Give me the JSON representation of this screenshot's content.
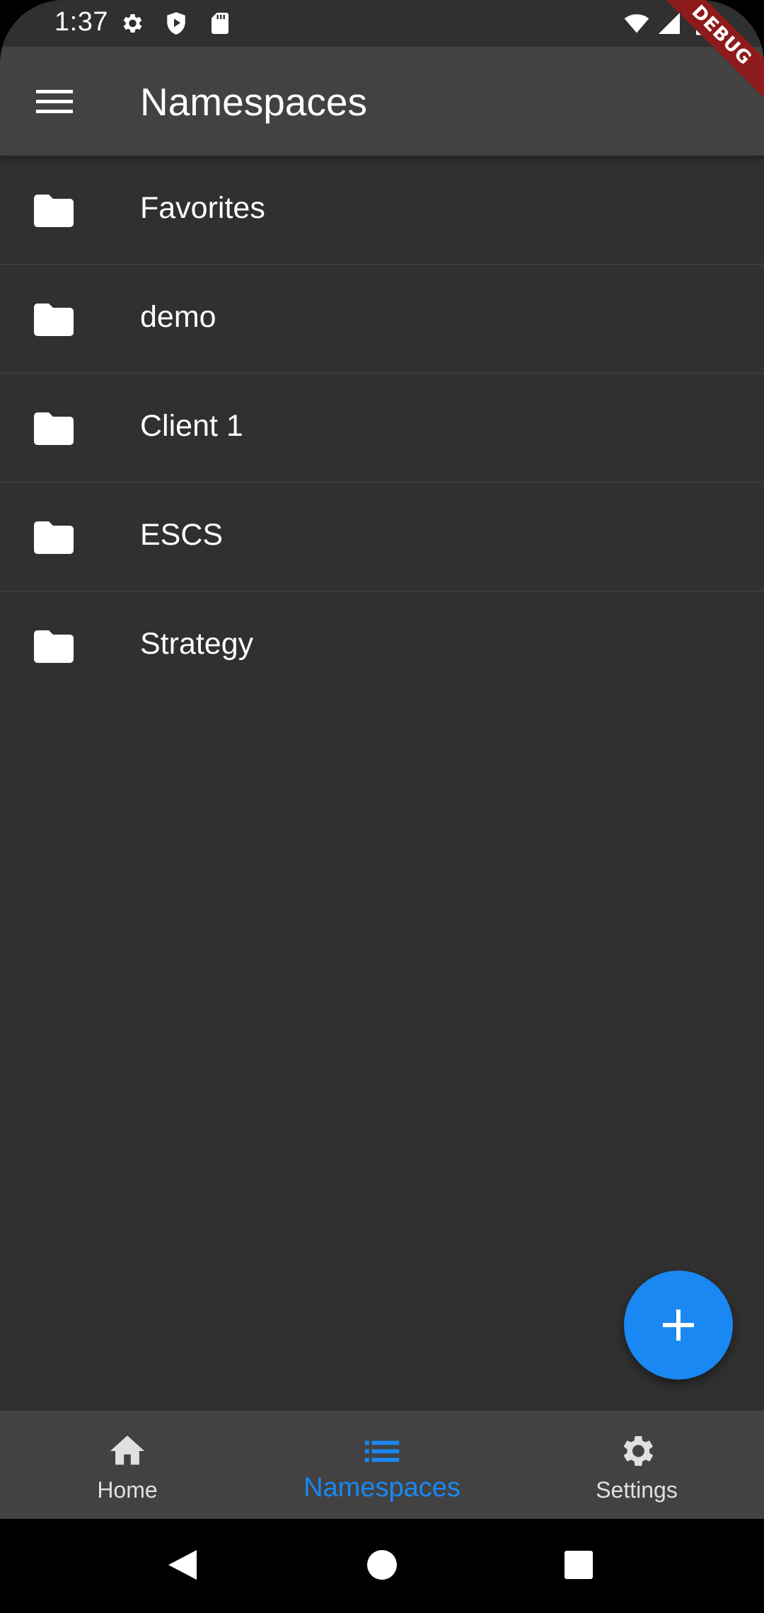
{
  "status_bar": {
    "time": "1:37",
    "icons": [
      "settings-icon",
      "shield-play-icon",
      "sd-card-icon",
      "wifi-icon",
      "signal-icon",
      "battery-icon"
    ]
  },
  "debug_banner": "DEBUG",
  "app_bar": {
    "title": "Namespaces",
    "menu_icon": "hamburger-menu-icon"
  },
  "namespaces": [
    {
      "label": "Favorites",
      "icon": "folder-icon"
    },
    {
      "label": "demo",
      "icon": "folder-icon"
    },
    {
      "label": "Client 1",
      "icon": "folder-icon"
    },
    {
      "label": "ESCS",
      "icon": "folder-icon"
    },
    {
      "label": "Strategy",
      "icon": "folder-icon"
    }
  ],
  "fab": {
    "icon": "plus-icon"
  },
  "bottom_nav": {
    "items": [
      {
        "label": "Home",
        "icon": "home-icon",
        "active": false
      },
      {
        "label": "Namespaces",
        "icon": "list-icon",
        "active": true
      },
      {
        "label": "Settings",
        "icon": "gear-icon",
        "active": false
      }
    ]
  },
  "colors": {
    "background": "#303030",
    "app_bar": "#424242",
    "accent": "#1a88f2",
    "text": "#ffffff",
    "inactive_nav": "#e0e0e0",
    "debug_ribbon": "#8e1b1b"
  },
  "system_nav": {
    "icons": [
      "back-icon",
      "home-circle-icon",
      "recents-icon"
    ]
  }
}
